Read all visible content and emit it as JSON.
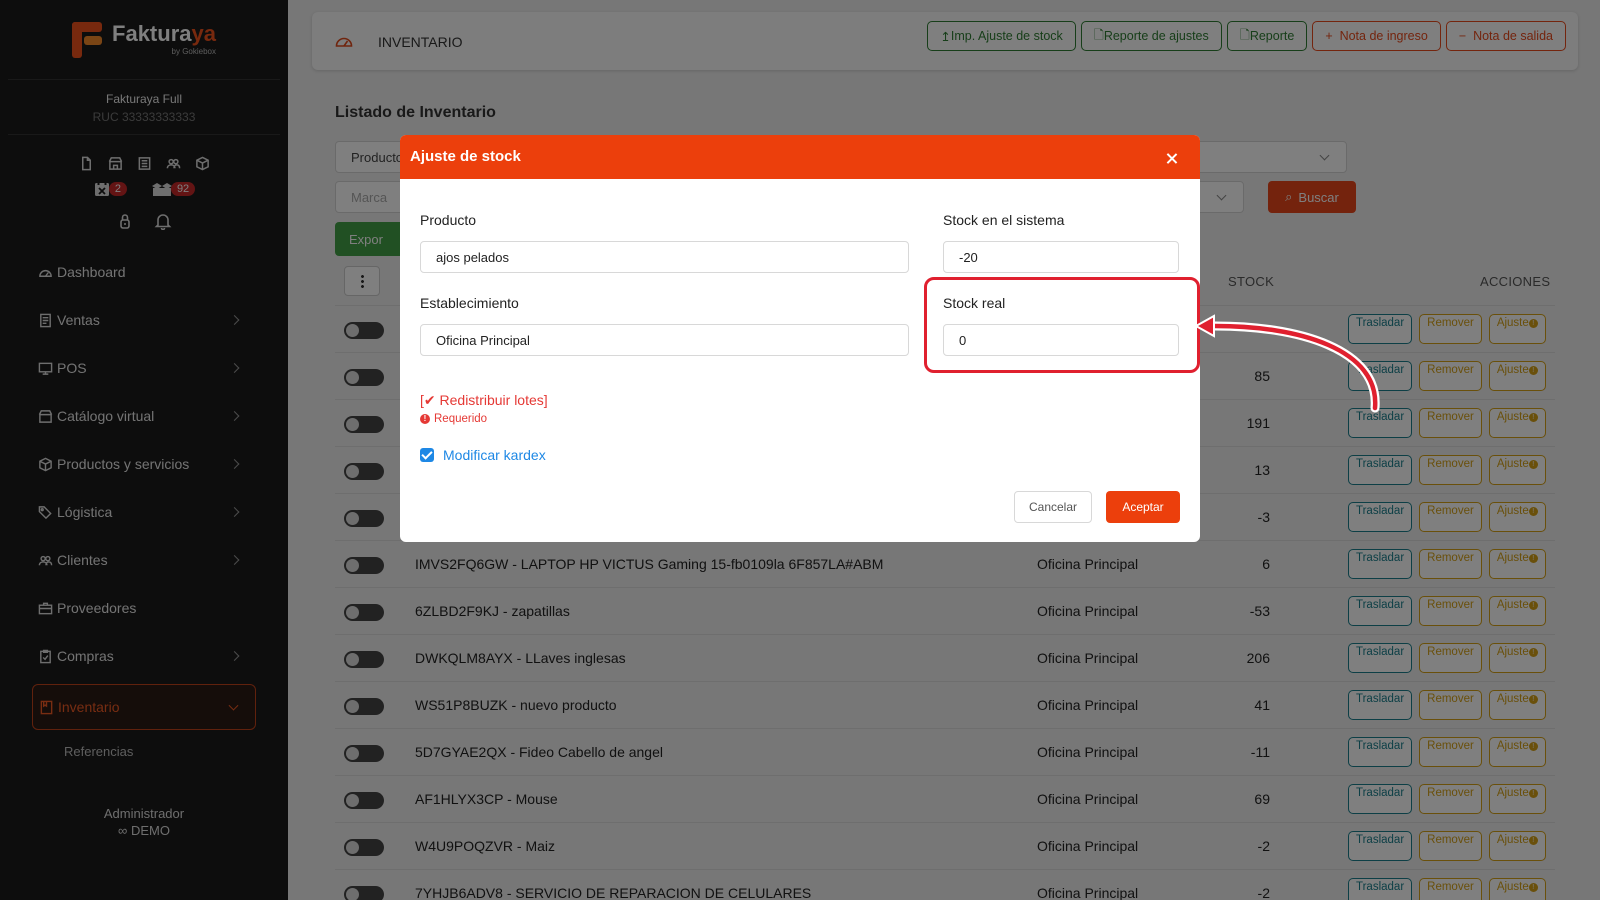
{
  "brand": {
    "name_a": "Faktura",
    "name_b": "ya",
    "sub": "by Gokiebox"
  },
  "company": {
    "name": "Fakturaya Full",
    "ruc": "RUC 33333333333"
  },
  "badges": {
    "calendar_count": "2",
    "box_count": "92"
  },
  "sidebar": {
    "items": [
      {
        "label": "Dashboard"
      },
      {
        "label": "Ventas"
      },
      {
        "label": "POS"
      },
      {
        "label": "Catálogo virtual"
      },
      {
        "label": "Productos y servicios"
      },
      {
        "label": "Lógistica"
      },
      {
        "label": "Clientes"
      },
      {
        "label": "Proveedores"
      },
      {
        "label": "Compras"
      },
      {
        "label": "Inventario"
      }
    ],
    "subitem": "Referencias"
  },
  "user": {
    "role": "Administrador",
    "name": "DEMO"
  },
  "topbar": {
    "title": "INVENTARIO",
    "buttons": [
      "Imp. Ajuste de stock",
      "Reporte de ajustes",
      "Reporte",
      "Nota de ingreso",
      "Nota de salida"
    ]
  },
  "page": {
    "title": "Listado de Inventario",
    "filter1": "Producto",
    "filter2_placeholder": "Marca",
    "search_label": "Buscar",
    "export_label": "Expor",
    "col_stock": "STOCK",
    "col_acciones": "ACCIONES"
  },
  "actions": {
    "move": "Trasladar",
    "remove": "Remover",
    "adjust": "Ajuste"
  },
  "rows": [
    {
      "desc": "",
      "est": "",
      "stock": ""
    },
    {
      "desc": "",
      "est": "",
      "stock": "85"
    },
    {
      "desc": "",
      "est": "",
      "stock": "191"
    },
    {
      "desc": "",
      "est": "",
      "stock": "13"
    },
    {
      "desc": "",
      "est": "",
      "stock": "-3"
    },
    {
      "desc": "IMVS2FQ6GW - LAPTOP HP VICTUS Gaming 15-fb0109la 6F857LA#ABM",
      "est": "Oficina Principal",
      "stock": "6"
    },
    {
      "desc": "6ZLBD2F9KJ - zapatillas",
      "est": "Oficina Principal",
      "stock": "-53"
    },
    {
      "desc": "DWKQLM8AYX - LLaves inglesas",
      "est": "Oficina Principal",
      "stock": "206"
    },
    {
      "desc": "WS51P8BUZK - nuevo producto",
      "est": "Oficina Principal",
      "stock": "41"
    },
    {
      "desc": "5D7GYAE2QX - Fideo Cabello de angel",
      "est": "Oficina Principal",
      "stock": "-11"
    },
    {
      "desc": "AF1HLYX3CP - Mouse",
      "est": "Oficina Principal",
      "stock": "69"
    },
    {
      "desc": "W4U9POQZVR - Maiz",
      "est": "Oficina Principal",
      "stock": "-2"
    },
    {
      "desc": "7YHJB6ADV8 - SERVICIO DE REPARACION DE CELULARES",
      "est": "Oficina Principal",
      "stock": "-2"
    }
  ],
  "modal": {
    "title": "Ajuste de stock",
    "producto_label": "Producto",
    "producto_value": "ajos pelados",
    "stock_sistema_label": "Stock en el sistema",
    "stock_sistema_value": "-20",
    "establecimiento_label": "Establecimiento",
    "establecimiento_value": "Oficina Principal",
    "stock_real_label": "Stock real",
    "stock_real_value": "0",
    "redistribuir": "[✔ Redistribuir lotes]",
    "requerido": "Requerido",
    "kardex_label": "Modificar kardex",
    "cancel": "Cancelar",
    "accept": "Aceptar"
  },
  "colors": {
    "accent": "#ec3f0c",
    "sidebar_bg": "#1b1b1b",
    "green": "#2e7d32",
    "teal": "#1a7f8c",
    "gold": "#d4a017"
  }
}
